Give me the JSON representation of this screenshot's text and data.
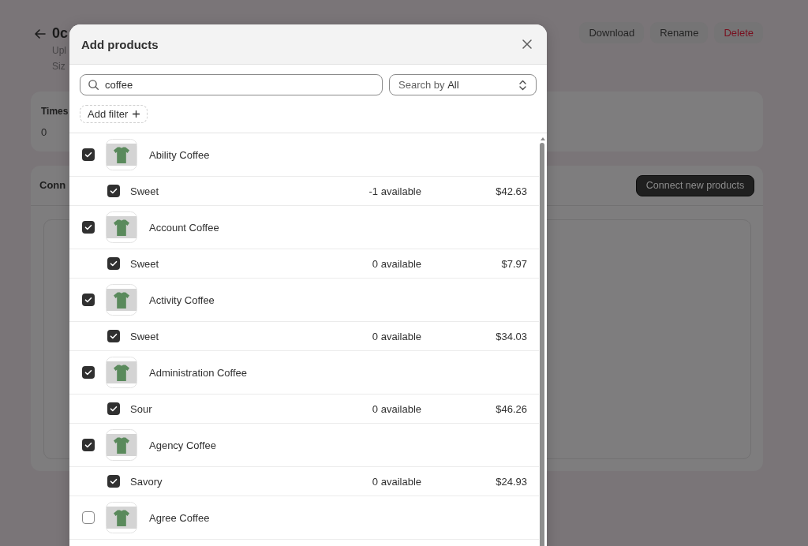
{
  "page": {
    "title": "0c",
    "details": [
      "Upl",
      "Siz"
    ],
    "actions": [
      {
        "label": "Download",
        "kind": "default"
      },
      {
        "label": "Rename",
        "kind": "default"
      },
      {
        "label": "Delete",
        "kind": "critical"
      }
    ],
    "summary_card": {
      "heading": "Times",
      "value": "0"
    },
    "connections_card": {
      "heading": "Conn",
      "button": "Connect new products"
    }
  },
  "modal": {
    "title": "Add products",
    "search": {
      "value": "coffee"
    },
    "search_by": {
      "label": "Search by",
      "value": "All"
    },
    "filter_button": {
      "label": "Add filter"
    },
    "products": [
      {
        "name": "Ability Coffee",
        "checked": true,
        "variants": [
          {
            "name": "Sweet",
            "checked": true,
            "availability": "-1 available",
            "price": "$42.63"
          }
        ]
      },
      {
        "name": "Account Coffee",
        "checked": true,
        "variants": [
          {
            "name": "Sweet",
            "checked": true,
            "availability": "0 available",
            "price": "$7.97"
          }
        ]
      },
      {
        "name": "Activity Coffee",
        "checked": true,
        "variants": [
          {
            "name": "Sweet",
            "checked": true,
            "availability": "0 available",
            "price": "$34.03"
          }
        ]
      },
      {
        "name": "Administration Coffee",
        "checked": true,
        "variants": [
          {
            "name": "Sour",
            "checked": true,
            "availability": "0 available",
            "price": "$46.26"
          }
        ]
      },
      {
        "name": "Agency Coffee",
        "checked": true,
        "variants": [
          {
            "name": "Savory",
            "checked": true,
            "availability": "0 available",
            "price": "$24.93"
          }
        ]
      },
      {
        "name": "Agree Coffee",
        "checked": false
      }
    ]
  }
}
